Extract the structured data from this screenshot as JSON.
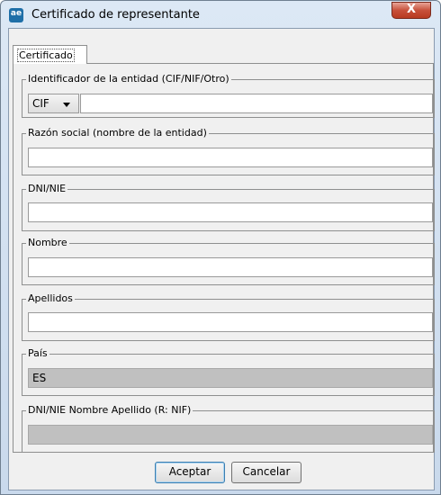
{
  "window": {
    "title": "Certificado de representante",
    "close_label": "X",
    "icon_text": "ae"
  },
  "tabs": [
    {
      "label": "Certificado"
    }
  ],
  "form": {
    "identificador": {
      "legend": "Identificador de la entidad (CIF/NIF/Otro)",
      "type_value": "CIF",
      "value": ""
    },
    "razon_social": {
      "legend": "Razón social (nombre de la entidad)",
      "value": ""
    },
    "dni_nie": {
      "legend": "DNI/NIE",
      "value": ""
    },
    "nombre": {
      "legend": "Nombre",
      "value": ""
    },
    "apellidos": {
      "legend": "Apellidos",
      "value": ""
    },
    "pais": {
      "legend": "País",
      "value": "ES"
    },
    "resumen": {
      "legend": "DNI/NIE Nombre Apellido (R: NIF)",
      "value": ""
    }
  },
  "buttons": {
    "accept": "Aceptar",
    "cancel": "Cancelar"
  },
  "colors": {
    "disabled_field": "#c0c0c0",
    "close_button": "#c7503a",
    "app_icon": "#1e6fa8"
  }
}
